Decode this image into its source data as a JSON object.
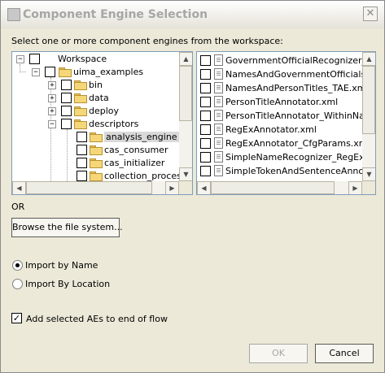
{
  "window": {
    "title": "Component Engine Selection",
    "close_glyph": "✕"
  },
  "instruction": "Select one or more component engines from the workspace:",
  "tree": {
    "items": [
      {
        "label": "Workspace"
      },
      {
        "label": "uima_examples"
      },
      {
        "label": "bin"
      },
      {
        "label": "data"
      },
      {
        "label": "deploy"
      },
      {
        "label": "descriptors"
      },
      {
        "label": "analysis_engine",
        "selected": true
      },
      {
        "label": "cas_consumer"
      },
      {
        "label": "cas_initializer"
      },
      {
        "label": "collection_process"
      }
    ]
  },
  "files": {
    "items": [
      {
        "label": "GovernmentOfficialRecognizer_Re"
      },
      {
        "label": "NamesAndGovernmentOfficials_TA"
      },
      {
        "label": "NamesAndPersonTitles_TAE.xml"
      },
      {
        "label": "PersonTitleAnnotator.xml"
      },
      {
        "label": "PersonTitleAnnotator_WithinName"
      },
      {
        "label": "RegExAnnotator.xml"
      },
      {
        "label": "RegExAnnotator_CfgParams.xml"
      },
      {
        "label": "SimpleNameRecognizer_RegEx_TA"
      },
      {
        "label": "SimpleTokenAndSentenceAnnotato"
      }
    ]
  },
  "or_label": "OR",
  "browse_button": "Browse the file system...",
  "import_options": {
    "by_name": "Import by Name",
    "by_location": "Import By Location",
    "selected": "Import by Name"
  },
  "add_to_flow": {
    "label": "Add selected AEs to end of flow",
    "checked": true
  },
  "buttons": {
    "ok": "OK",
    "cancel": "Cancel"
  }
}
